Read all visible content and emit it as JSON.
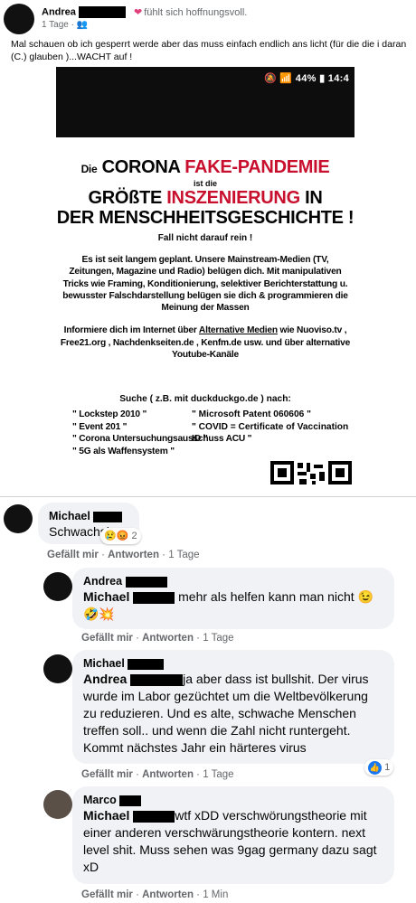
{
  "post": {
    "author": "Andrea",
    "feeling": "fühlt sich hoffnungsvoll.",
    "time": "1 Tage",
    "audience_icon": "friends-icon",
    "text": "Mal schauen ob ich gesperrt werde aber das muss einfach endlich ans licht (für die die i daran (C.) glauben )...WACHT auf !"
  },
  "image": {
    "status": {
      "icons": "wifi-signal-icon",
      "battery": "44%",
      "time": "14:4"
    },
    "line1_small": "Die",
    "line1_black": "CORONA",
    "line1_red": "FAKE-PANDEMIE",
    "istdie": "ist die",
    "line2_black": "GRÖßTE",
    "line2_red": "INSZENIERUNG",
    "line2_end": "IN",
    "line3": "DER MENSCHHEITSGESCHICHTE !",
    "fall": "Fall nicht darauf rein !",
    "para1": "Es ist seit langem geplant. Unsere Mainstream-Medien (TV, Zeitungen, Magazine und Radio) belügen dich. Mit manipulativen Tricks wie Framing, Konditionierung, selektiver Berichterstattung u. bewusster Falschdarstellung belügen sie dich & programmieren die Meinung der Massen",
    "para2_a": "Informiere dich im Internet über",
    "para2_u": "Alternative Medien",
    "para2_b": "wie Nuoviso.tv , Free21.org , Nachdenkseiten.de , Kenfm.de usw. und über alternative Youtube-Kanäle",
    "search_title": "Suche ( z.B. mit duckduckgo.de ) nach:",
    "search_left": [
      "\" Lockstep 2010 \"",
      "\" Event 201 \"",
      "\" Corona Untersuchungsausschuss ACU \"",
      "\" 5G als Waffensystem \""
    ],
    "search_right": [
      "\" Microsoft Patent 060606 \"",
      "\" COVID = Certificate of Vaccination ID \""
    ]
  },
  "comments": [
    {
      "name": "Michael",
      "mention": "",
      "text": "Schwachsinn",
      "reactions": {
        "count": "2",
        "icons": [
          "sad-reaction-icon",
          "angry-reaction-icon"
        ]
      },
      "like": "Gefällt mir",
      "reply": "Antworten",
      "time": "1 Tage"
    },
    {
      "name": "Andrea",
      "mention": "Michael",
      "text": "mehr als helfen kann man nicht 😉",
      "text2": "🤣💥",
      "like": "Gefällt mir",
      "reply": "Antworten",
      "time": "1 Tage"
    },
    {
      "name": "Michael",
      "mention": "Andrea",
      "text": "ja aber dass ist bullshit. Der virus wurde im Labor gezüchtet um die Weltbevölkerung zu reduzieren. Und es alte, schwache Menschen treffen soll.. und wenn die Zahl nicht runtergeht. Kommt nächstes Jahr ein härteres virus",
      "reactions": {
        "count": "1",
        "icons": [
          "like-reaction-icon"
        ]
      },
      "like": "Gefällt mir",
      "reply": "Antworten",
      "time": "1 Tage"
    },
    {
      "name": "Marco",
      "mention": "Michael",
      "text": "wtf xDD verschwörungstheorie mit einer anderen verschwärungstheorie kontern. next level shit. Muss sehen was 9gag germany dazu sagt xD",
      "like": "Gefällt mir",
      "reply": "Antworten",
      "time": "1 Min"
    }
  ]
}
